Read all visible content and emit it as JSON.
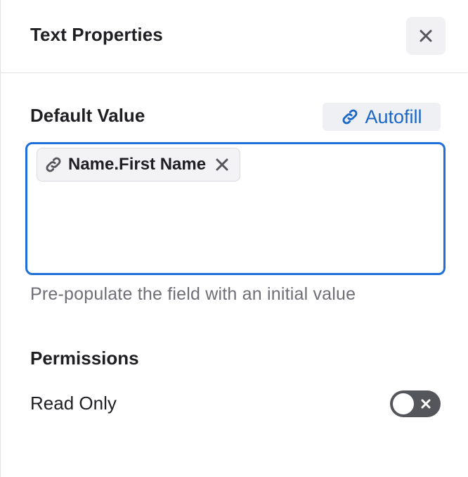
{
  "panel": {
    "title": "Text Properties",
    "close_icon": "close-icon"
  },
  "default_value": {
    "label": "Default Value",
    "autofill_label": "Autofill",
    "autofill_icon": "link-icon",
    "chip": {
      "label": "Name.First Name",
      "icon": "link-icon",
      "remove_icon": "close-icon"
    },
    "help_text": "Pre-populate the field with an initial value"
  },
  "permissions": {
    "label": "Permissions",
    "read_only": {
      "label": "Read Only",
      "enabled": false
    }
  },
  "colors": {
    "accent": "#1e6fd9",
    "link": "#1a66c9",
    "toggle_off": "#55555c",
    "muted_text": "#6e6e76"
  }
}
